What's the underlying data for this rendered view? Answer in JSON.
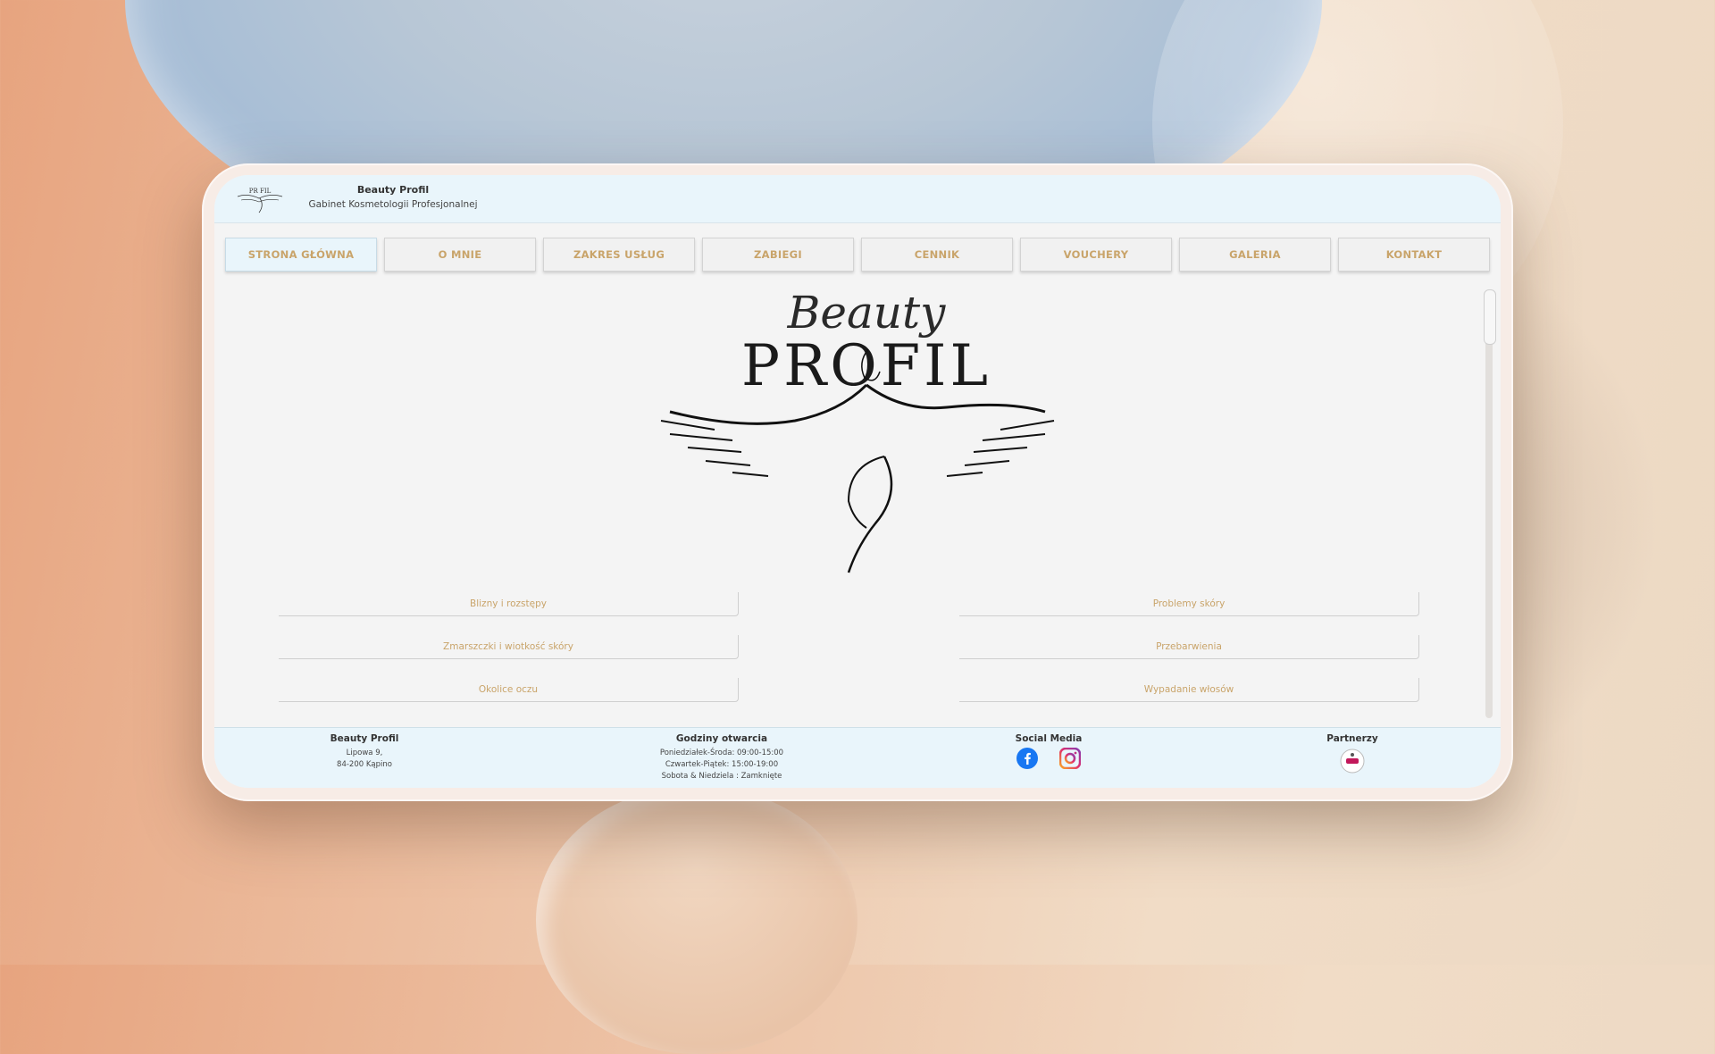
{
  "site": {
    "name": "Beauty Profil",
    "subtitle": "Gabinet Kosmetologii Profesjonalnej"
  },
  "nav": {
    "items": [
      {
        "label": "STRONA GŁÓWNA",
        "active": true
      },
      {
        "label": "O MNIE"
      },
      {
        "label": "ZAKRES USŁUG"
      },
      {
        "label": "ZABIEGI"
      },
      {
        "label": "CENNIK"
      },
      {
        "label": "VOUCHERY"
      },
      {
        "label": "GALERIA"
      },
      {
        "label": "KONTAKT"
      }
    ]
  },
  "hero": {
    "logo_line1": "Beauty",
    "logo_line2": "PROFIL"
  },
  "services": {
    "left": [
      "Blizny i rozstępy",
      "Zmarszczki i wiotkość skóry",
      "Okolice oczu"
    ],
    "right": [
      "Problemy skóry",
      "Przebarwienia",
      "Wypadanie włosów"
    ]
  },
  "footer": {
    "address": {
      "title": "Beauty Profil",
      "line1": "Lipowa 9,",
      "line2": "84-200 Kąpino"
    },
    "hours": {
      "title": "Godziny otwarcia",
      "line1": "Poniedziałek-Środa: 09:00-15:00",
      "line2": "Czwartek-Piątek: 15:00-19:00",
      "line3": "Sobota & Niedziela : Zamknięte"
    },
    "social": {
      "title": "Social Media",
      "icons": [
        "facebook-icon",
        "instagram-icon"
      ]
    },
    "partners": {
      "title": "Partnerzy"
    }
  },
  "colors": {
    "accent": "#c9a46a",
    "header_bg": "#e9f5fb"
  }
}
